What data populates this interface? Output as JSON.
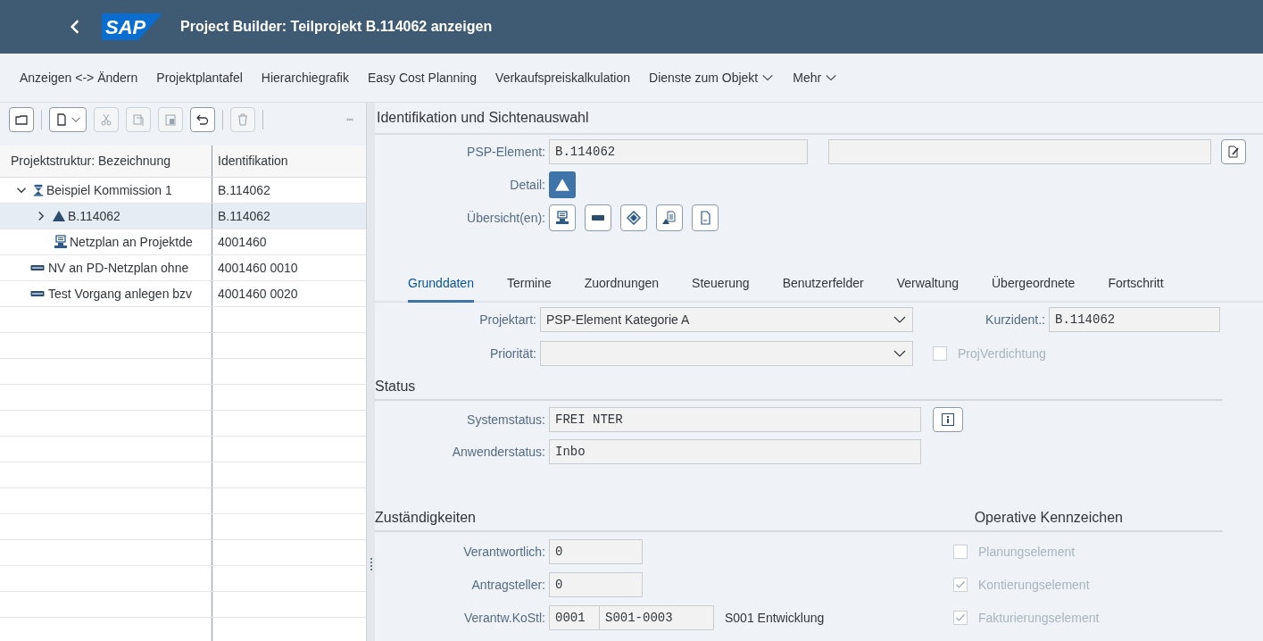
{
  "shell": {
    "logo": "SAP",
    "title": "Project Builder: Teilprojekt B.114062 anzeigen"
  },
  "menu": [
    {
      "label": "Anzeigen <-> Ändern",
      "dropdown": false
    },
    {
      "label": "Projektplantafel",
      "dropdown": false
    },
    {
      "label": "Hierarchiegrafik",
      "dropdown": false
    },
    {
      "label": "Easy Cost Planning",
      "dropdown": false
    },
    {
      "label": "Verkaufspreiskalkulation",
      "dropdown": false
    },
    {
      "label": "Dienste zum Objekt",
      "dropdown": true
    },
    {
      "label": "Mehr",
      "dropdown": true
    }
  ],
  "toolbar": [
    {
      "kind": "folder",
      "disabled": false
    },
    {
      "kind": "new",
      "disabled": false
    },
    {
      "kind": "cut",
      "disabled": true
    },
    {
      "kind": "copy",
      "disabled": true
    },
    {
      "kind": "paste",
      "disabled": true
    },
    {
      "kind": "undo",
      "disabled": false
    },
    {
      "kind": "delete",
      "disabled": true
    }
  ],
  "tree": {
    "columns": [
      "Projektstruktur: Bezeichnung",
      "Identifikation"
    ],
    "rows": [
      {
        "label": "Beispiel Kommission 1",
        "id": "B.114062",
        "kind": "project",
        "expanded": true,
        "selected": false,
        "children": [
          {
            "label": "B.114062",
            "id": "B.114062",
            "kind": "wbs",
            "expanded": false,
            "selected": true
          },
          {
            "label": "Netzplan an Projektde",
            "id": "4001460",
            "kind": "network",
            "selected": false
          }
        ]
      },
      {
        "label": "NV an PD-Netzplan ohne",
        "id": "4001460 0010",
        "kind": "activity",
        "selected": false
      },
      {
        "label": "Test Vorgang anlegen bzv",
        "id": "4001460 0020",
        "kind": "activity",
        "selected": false
      }
    ]
  },
  "identification": {
    "title": "Identifikation und Sichtenauswahl",
    "psp_label": "PSP-Element:",
    "psp_value": "B.114062",
    "detail_label": "Detail:",
    "overview_label": "Übersicht(en):"
  },
  "tabs": [
    {
      "label": "Grunddaten",
      "selected": true
    },
    {
      "label": "Termine",
      "selected": false
    },
    {
      "label": "Zuordnungen",
      "selected": false
    },
    {
      "label": "Steuerung",
      "selected": false
    },
    {
      "label": "Benutzerfelder",
      "selected": false
    },
    {
      "label": "Verwaltung",
      "selected": false
    },
    {
      "label": "Übergeordnete",
      "selected": false
    },
    {
      "label": "Fortschritt",
      "selected": false
    }
  ],
  "basic": {
    "projektart_label": "Projektart:",
    "projektart_value": "PSP-Element Kategorie A",
    "prioritaet_label": "Priorität:",
    "kurzident_label": "Kurzident.:",
    "kurzident_value": "B.114062",
    "verdichtung": {
      "label": "ProjVerdichtung",
      "checked": false
    }
  },
  "status": {
    "title": "Status",
    "system_label": "Systemstatus:",
    "system_value": "FREI NTER",
    "user_label": "Anwenderstatus:",
    "user_value": "Inbo"
  },
  "responsibilities": {
    "title": "Zuständigkeiten",
    "rows": [
      {
        "label": "Verantwortlich:",
        "values": [
          "0"
        ]
      },
      {
        "label": "Antragsteller:",
        "values": [
          "0"
        ]
      },
      {
        "label": "Verantw.KoStl:",
        "values": [
          "0001",
          "S001-0003"
        ],
        "text": "S001 Entwicklung"
      }
    ]
  },
  "operative": {
    "title": "Operative Kennzeichen",
    "flags": [
      {
        "label": "Planungselement",
        "checked": false
      },
      {
        "label": "Kontierungselement",
        "checked": true
      },
      {
        "label": "Fakturierungselement",
        "checked": true
      }
    ]
  }
}
